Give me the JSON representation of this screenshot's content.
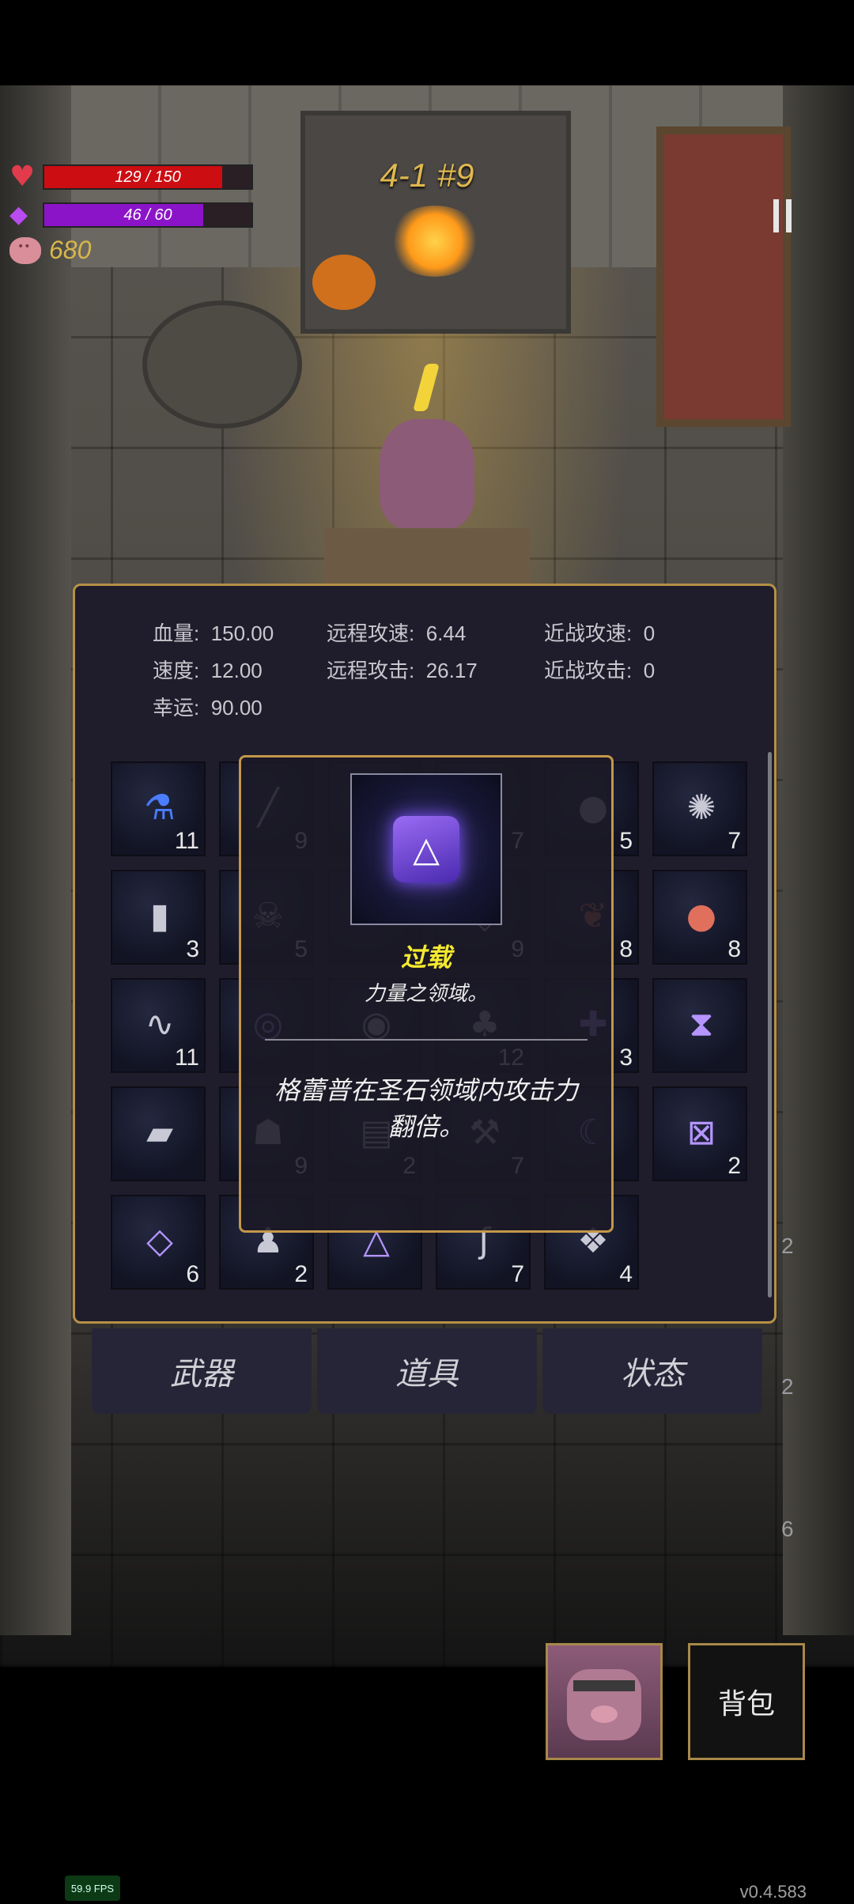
{
  "hud": {
    "hp_text": "129 / 150",
    "hp_fraction": 0.86,
    "mp_text": "46 / 60",
    "mp_fraction": 0.767,
    "gold": "680",
    "level": "4-1 #9",
    "colors": {
      "hp": "#cc0d12",
      "mp": "#8b14c8",
      "gold": "#d8b64a"
    }
  },
  "stats": {
    "hp_label": "血量:",
    "hp_value": "150.00",
    "ranged_speed_label": "远程攻速:",
    "ranged_speed_value": "6.44",
    "melee_speed_label": "近战攻速:",
    "melee_speed_value": "0",
    "speed_label": "速度:",
    "speed_value": "12.00",
    "ranged_attack_label": "远程攻击:",
    "ranged_attack_value": "26.17",
    "melee_attack_label": "近战攻击:",
    "melee_attack_value": "0",
    "luck_label": "幸运:",
    "luck_value": "90.00"
  },
  "inventory": {
    "slots": [
      {
        "icon": "blue-potion-icon",
        "glyph": "⚗",
        "count": "11"
      },
      {
        "icon": "wand-icon",
        "glyph": "╱",
        "count": "9"
      },
      {
        "icon": "rune-icon",
        "glyph": "◇",
        "count": ""
      },
      {
        "icon": "gem-icon",
        "glyph": "◆",
        "count": "7"
      },
      {
        "icon": "orb-icon",
        "glyph": "●",
        "count": "5"
      },
      {
        "icon": "tentacle-icon",
        "glyph": "✺",
        "count": "7"
      },
      {
        "icon": "tablet-icon",
        "glyph": "▮",
        "count": "3"
      },
      {
        "icon": "mask-icon",
        "glyph": "☠",
        "count": "5"
      },
      {
        "icon": "scroll-icon",
        "glyph": "✉",
        "count": ""
      },
      {
        "icon": "crystal-icon",
        "glyph": "◈",
        "count": "9"
      },
      {
        "icon": "heart-fruit-icon",
        "glyph": "❦",
        "count": "8"
      },
      {
        "icon": "apple-icon",
        "glyph": "●",
        "count": "8"
      },
      {
        "icon": "worm-icon",
        "glyph": "∿",
        "count": "11"
      },
      {
        "icon": "spiral-rune-icon",
        "glyph": "◎",
        "count": ""
      },
      {
        "icon": "eye-icon",
        "glyph": "◉",
        "count": ""
      },
      {
        "icon": "clover-icon",
        "glyph": "♣",
        "count": "12"
      },
      {
        "icon": "shield-rune-icon",
        "glyph": "✚",
        "count": "3"
      },
      {
        "icon": "hourglass-rune-icon",
        "glyph": "⧗",
        "count": ""
      },
      {
        "icon": "spellbook-icon",
        "glyph": "▰",
        "count": ""
      },
      {
        "icon": "ghost-icon",
        "glyph": "☗",
        "count": "9"
      },
      {
        "icon": "book-icon",
        "glyph": "▤",
        "count": "2"
      },
      {
        "icon": "hammer-icon",
        "glyph": "⚒",
        "count": "7"
      },
      {
        "icon": "curve-rune-icon",
        "glyph": "☾",
        "count": ""
      },
      {
        "icon": "cross-rune-icon",
        "glyph": "⊠",
        "count": "2"
      },
      {
        "icon": "diamond-rune-icon",
        "glyph": "◇",
        "count": "6"
      },
      {
        "icon": "chess-pawn-icon",
        "glyph": "♟",
        "count": "2"
      },
      {
        "icon": "triangle-rune-icon",
        "glyph": "△",
        "count": ""
      },
      {
        "icon": "hook-icon",
        "glyph": "ʃ",
        "count": "7"
      },
      {
        "icon": "stacked-diamond-icon",
        "glyph": "❖",
        "count": "4"
      }
    ]
  },
  "tooltip": {
    "icon": "triangle-rune-icon",
    "glyph": "△",
    "name": "过载",
    "subtitle": "力量之领域。",
    "description": "格蕾普在圣石领域内攻击力翻倍。"
  },
  "side_numbers": {
    "a": "2",
    "b": "2",
    "c": "6"
  },
  "tabs": {
    "weapon": "武器",
    "items": "道具",
    "status": "状态"
  },
  "bottom": {
    "bag": "背包",
    "fps": "59.9 FPS",
    "version": "v0.4.583"
  }
}
